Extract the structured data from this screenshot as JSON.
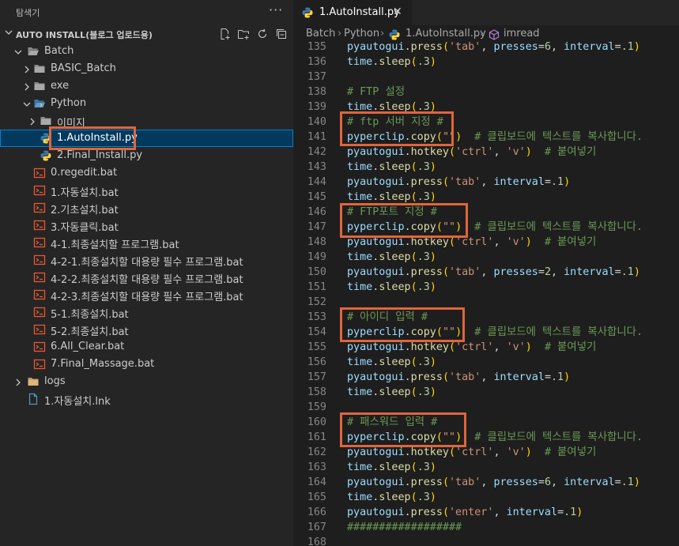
{
  "sidebar": {
    "title": "탐색기",
    "more": "···",
    "section_title": "AUTO INSTALL(블로그 업로드용)",
    "tree": [
      {
        "label": "Batch",
        "type": "folder",
        "expanded": true,
        "level": 1
      },
      {
        "label": "BASIC_Batch",
        "type": "folder",
        "expanded": false,
        "level": 2
      },
      {
        "label": "exe",
        "type": "folder",
        "expanded": false,
        "level": 2
      },
      {
        "label": "Python",
        "type": "folder",
        "expanded": true,
        "level": 2
      },
      {
        "label": "이미지",
        "type": "folder",
        "expanded": false,
        "level": 3
      },
      {
        "label": "1.AutoInstall.py",
        "type": "py",
        "level": 3,
        "selected": true
      },
      {
        "label": "2.Final_Install.py",
        "type": "py",
        "level": 3
      },
      {
        "label": "0.regedit.bat",
        "type": "bat",
        "level": 2
      },
      {
        "label": "1.자동설치.bat",
        "type": "bat",
        "level": 2
      },
      {
        "label": "2.기초설치.bat",
        "type": "bat",
        "level": 2
      },
      {
        "label": "3.자동클릭.bat",
        "type": "bat",
        "level": 2
      },
      {
        "label": "4-1.최종설치할 프로그램.bat",
        "type": "bat",
        "level": 2
      },
      {
        "label": "4-2-1.최종설치할 대용량 필수 프로그램.bat",
        "type": "bat",
        "level": 2
      },
      {
        "label": "4-2-2.최종설치할 대용량 필수 프로그램.bat",
        "type": "bat",
        "level": 2
      },
      {
        "label": "4-2-3.최종설치할 대용량 필수 프로그램.bat",
        "type": "bat",
        "level": 2
      },
      {
        "label": "5-1.최종설치.bat",
        "type": "bat",
        "level": 2
      },
      {
        "label": "5-2.최종설치.bat",
        "type": "bat",
        "level": 2
      },
      {
        "label": "6.All_Clear.bat",
        "type": "bat",
        "level": 2
      },
      {
        "label": "7.Final_Massage.bat",
        "type": "bat",
        "level": 2
      },
      {
        "label": "logs",
        "type": "folder-yellow",
        "expanded": false,
        "level": 1
      },
      {
        "label": "1.자동설치.lnk",
        "type": "file",
        "level": 1
      }
    ]
  },
  "tab": {
    "label": "1.AutoInstall.py",
    "close": "✕"
  },
  "breadcrumb": [
    "Batch",
    "Python",
    "1.AutoInstall.py",
    "imread"
  ],
  "code": [
    {
      "n": "135",
      "t": [
        [
          "v",
          "pyautogui"
        ],
        [
          "p",
          "."
        ],
        [
          "f",
          "press"
        ],
        [
          "br",
          "("
        ],
        [
          "s",
          "'tab'"
        ],
        [
          "p",
          ", "
        ],
        [
          "v",
          "presses"
        ],
        [
          "p",
          "="
        ],
        [
          "n",
          "6"
        ],
        [
          "p",
          ", "
        ],
        [
          "v",
          "interval"
        ],
        [
          "p",
          "="
        ],
        [
          "n",
          ".1"
        ],
        [
          "br",
          ")"
        ]
      ]
    },
    {
      "n": "136",
      "t": [
        [
          "v",
          "time"
        ],
        [
          "p",
          "."
        ],
        [
          "f",
          "sleep"
        ],
        [
          "br",
          "("
        ],
        [
          "n",
          ".3"
        ],
        [
          "br",
          ")"
        ]
      ]
    },
    {
      "n": "137",
      "t": []
    },
    {
      "n": "138",
      "t": [
        [
          "c",
          "# FTP 설정"
        ]
      ]
    },
    {
      "n": "139",
      "t": [
        [
          "v",
          "time"
        ],
        [
          "p",
          "."
        ],
        [
          "f",
          "sleep"
        ],
        [
          "br",
          "("
        ],
        [
          "n",
          ".3"
        ],
        [
          "br",
          ")"
        ]
      ]
    },
    {
      "n": "140",
      "t": [
        [
          "c",
          "# ftp 서버 지정 #"
        ]
      ]
    },
    {
      "n": "141",
      "t": [
        [
          "v",
          "pyperclip"
        ],
        [
          "p",
          "."
        ],
        [
          "f",
          "copy"
        ],
        [
          "br",
          "("
        ],
        [
          "s",
          "\"\""
        ],
        [
          "br",
          ")"
        ],
        [
          "p",
          "  "
        ],
        [
          "c",
          "# 클립보드에 텍스트를 복사합니다."
        ]
      ]
    },
    {
      "n": "142",
      "t": [
        [
          "v",
          "pyautogui"
        ],
        [
          "p",
          "."
        ],
        [
          "f",
          "hotkey"
        ],
        [
          "br",
          "("
        ],
        [
          "s",
          "'ctrl'"
        ],
        [
          "p",
          ", "
        ],
        [
          "s",
          "'v'"
        ],
        [
          "br",
          ")"
        ],
        [
          "p",
          "  "
        ],
        [
          "c",
          "# 붙여넣기"
        ]
      ]
    },
    {
      "n": "143",
      "t": [
        [
          "v",
          "time"
        ],
        [
          "p",
          "."
        ],
        [
          "f",
          "sleep"
        ],
        [
          "br",
          "("
        ],
        [
          "n",
          ".3"
        ],
        [
          "br",
          ")"
        ]
      ]
    },
    {
      "n": "144",
      "t": [
        [
          "v",
          "pyautogui"
        ],
        [
          "p",
          "."
        ],
        [
          "f",
          "press"
        ],
        [
          "br",
          "("
        ],
        [
          "s",
          "'tab'"
        ],
        [
          "p",
          ", "
        ],
        [
          "v",
          "interval"
        ],
        [
          "p",
          "="
        ],
        [
          "n",
          ".1"
        ],
        [
          "br",
          ")"
        ]
      ]
    },
    {
      "n": "145",
      "t": [
        [
          "v",
          "time"
        ],
        [
          "p",
          "."
        ],
        [
          "f",
          "sleep"
        ],
        [
          "br",
          "("
        ],
        [
          "n",
          ".3"
        ],
        [
          "br",
          ")"
        ]
      ]
    },
    {
      "n": "146",
      "t": [
        [
          "c",
          "# FTP포트 지정 #"
        ]
      ]
    },
    {
      "n": "147",
      "t": [
        [
          "v",
          "pyperclip"
        ],
        [
          "p",
          "."
        ],
        [
          "f",
          "copy"
        ],
        [
          "br",
          "("
        ],
        [
          "s",
          "\"\""
        ],
        [
          "br",
          ")"
        ],
        [
          "p",
          "  "
        ],
        [
          "c",
          "# 클립보드에 텍스트를 복사합니다."
        ]
      ]
    },
    {
      "n": "148",
      "t": [
        [
          "v",
          "pyautogui"
        ],
        [
          "p",
          "."
        ],
        [
          "f",
          "hotkey"
        ],
        [
          "br",
          "("
        ],
        [
          "s",
          "'ctrl'"
        ],
        [
          "p",
          ", "
        ],
        [
          "s",
          "'v'"
        ],
        [
          "br",
          ")"
        ],
        [
          "p",
          "  "
        ],
        [
          "c",
          "# 붙여넣기"
        ]
      ]
    },
    {
      "n": "149",
      "t": [
        [
          "v",
          "time"
        ],
        [
          "p",
          "."
        ],
        [
          "f",
          "sleep"
        ],
        [
          "br",
          "("
        ],
        [
          "n",
          ".3"
        ],
        [
          "br",
          ")"
        ]
      ]
    },
    {
      "n": "150",
      "t": [
        [
          "v",
          "pyautogui"
        ],
        [
          "p",
          "."
        ],
        [
          "f",
          "press"
        ],
        [
          "br",
          "("
        ],
        [
          "s",
          "'tab'"
        ],
        [
          "p",
          ", "
        ],
        [
          "v",
          "presses"
        ],
        [
          "p",
          "="
        ],
        [
          "n",
          "2"
        ],
        [
          "p",
          ", "
        ],
        [
          "v",
          "interval"
        ],
        [
          "p",
          "="
        ],
        [
          "n",
          ".1"
        ],
        [
          "br",
          ")"
        ]
      ]
    },
    {
      "n": "151",
      "t": [
        [
          "v",
          "time"
        ],
        [
          "p",
          "."
        ],
        [
          "f",
          "sleep"
        ],
        [
          "br",
          "("
        ],
        [
          "n",
          ".3"
        ],
        [
          "br",
          ")"
        ]
      ]
    },
    {
      "n": "152",
      "t": []
    },
    {
      "n": "153",
      "t": [
        [
          "c",
          "# 아이디 입력 #"
        ]
      ]
    },
    {
      "n": "154",
      "t": [
        [
          "v",
          "pyperclip"
        ],
        [
          "p",
          "."
        ],
        [
          "f",
          "copy"
        ],
        [
          "br",
          "("
        ],
        [
          "s",
          "\"\""
        ],
        [
          "br",
          ")"
        ],
        [
          "p",
          "  "
        ],
        [
          "c",
          "# 클립보드에 텍스트를 복사합니다."
        ]
      ]
    },
    {
      "n": "155",
      "t": [
        [
          "v",
          "pyautogui"
        ],
        [
          "p",
          "."
        ],
        [
          "f",
          "hotkey"
        ],
        [
          "br",
          "("
        ],
        [
          "s",
          "'ctrl'"
        ],
        [
          "p",
          ", "
        ],
        [
          "s",
          "'v'"
        ],
        [
          "br",
          ")"
        ],
        [
          "p",
          "  "
        ],
        [
          "c",
          "# 붙여넣기"
        ]
      ]
    },
    {
      "n": "156",
      "t": [
        [
          "v",
          "time"
        ],
        [
          "p",
          "."
        ],
        [
          "f",
          "sleep"
        ],
        [
          "br",
          "("
        ],
        [
          "n",
          ".3"
        ],
        [
          "br",
          ")"
        ]
      ]
    },
    {
      "n": "157",
      "t": [
        [
          "v",
          "pyautogui"
        ],
        [
          "p",
          "."
        ],
        [
          "f",
          "press"
        ],
        [
          "br",
          "("
        ],
        [
          "s",
          "'tab'"
        ],
        [
          "p",
          ", "
        ],
        [
          "v",
          "interval"
        ],
        [
          "p",
          "="
        ],
        [
          "n",
          ".1"
        ],
        [
          "br",
          ")"
        ]
      ]
    },
    {
      "n": "158",
      "t": [
        [
          "v",
          "time"
        ],
        [
          "p",
          "."
        ],
        [
          "f",
          "sleep"
        ],
        [
          "br",
          "("
        ],
        [
          "n",
          ".3"
        ],
        [
          "br",
          ")"
        ]
      ]
    },
    {
      "n": "159",
      "t": []
    },
    {
      "n": "160",
      "t": [
        [
          "c",
          "# 패스워드 입력 #"
        ]
      ]
    },
    {
      "n": "161",
      "t": [
        [
          "v",
          "pyperclip"
        ],
        [
          "p",
          "."
        ],
        [
          "f",
          "copy"
        ],
        [
          "br",
          "("
        ],
        [
          "s",
          "\"\""
        ],
        [
          "br",
          ")"
        ],
        [
          "p",
          "  "
        ],
        [
          "c",
          "# 클립보드에 텍스트를 복사합니다."
        ]
      ]
    },
    {
      "n": "162",
      "t": [
        [
          "v",
          "pyautogui"
        ],
        [
          "p",
          "."
        ],
        [
          "f",
          "hotkey"
        ],
        [
          "br",
          "("
        ],
        [
          "s",
          "'ctrl'"
        ],
        [
          "p",
          ", "
        ],
        [
          "s",
          "'v'"
        ],
        [
          "br",
          ")"
        ],
        [
          "p",
          "  "
        ],
        [
          "c",
          "# 붙여넣기"
        ]
      ]
    },
    {
      "n": "163",
      "t": [
        [
          "v",
          "time"
        ],
        [
          "p",
          "."
        ],
        [
          "f",
          "sleep"
        ],
        [
          "br",
          "("
        ],
        [
          "n",
          ".3"
        ],
        [
          "br",
          ")"
        ]
      ]
    },
    {
      "n": "164",
      "t": [
        [
          "v",
          "pyautogui"
        ],
        [
          "p",
          "."
        ],
        [
          "f",
          "press"
        ],
        [
          "br",
          "("
        ],
        [
          "s",
          "'tab'"
        ],
        [
          "p",
          ", "
        ],
        [
          "v",
          "presses"
        ],
        [
          "p",
          "="
        ],
        [
          "n",
          "6"
        ],
        [
          "p",
          ", "
        ],
        [
          "v",
          "interval"
        ],
        [
          "p",
          "="
        ],
        [
          "n",
          ".1"
        ],
        [
          "br",
          ")"
        ]
      ]
    },
    {
      "n": "165",
      "t": [
        [
          "v",
          "time"
        ],
        [
          "p",
          "."
        ],
        [
          "f",
          "sleep"
        ],
        [
          "br",
          "("
        ],
        [
          "n",
          ".3"
        ],
        [
          "br",
          ")"
        ]
      ]
    },
    {
      "n": "166",
      "t": [
        [
          "v",
          "pyautogui"
        ],
        [
          "p",
          "."
        ],
        [
          "f",
          "press"
        ],
        [
          "br",
          "("
        ],
        [
          "s",
          "'enter'"
        ],
        [
          "p",
          ", "
        ],
        [
          "v",
          "interval"
        ],
        [
          "p",
          "="
        ],
        [
          "n",
          ".1"
        ],
        [
          "br",
          ")"
        ]
      ]
    },
    {
      "n": "167",
      "t": [
        [
          "c",
          "##################"
        ]
      ]
    },
    {
      "n": "168",
      "t": []
    }
  ],
  "colors": {
    "annotation_box": "#e0653c",
    "selection_bg": "#04395e",
    "comment": "#6a9955",
    "string": "#ce9178"
  }
}
